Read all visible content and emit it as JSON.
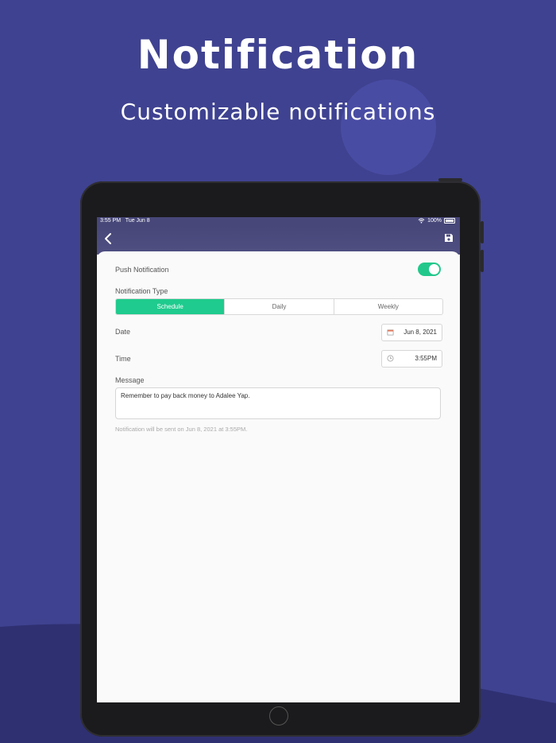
{
  "promo": {
    "title": "Notification",
    "subtitle": "Customizable notifications"
  },
  "status_bar": {
    "time": "3:55 PM",
    "date": "Tue Jun 8",
    "battery": "100%"
  },
  "nav": {
    "back_icon": "chevron-left-icon",
    "save_icon": "floppy-disk-icon"
  },
  "form": {
    "push_label": "Push Notification",
    "push_enabled": true,
    "type_label": "Notification Type",
    "type_options": [
      "Schedule",
      "Daily",
      "Weekly"
    ],
    "type_selected": "Schedule",
    "date_label": "Date",
    "date_value": "Jun 8, 2021",
    "time_label": "Time",
    "time_value": "3:55PM",
    "message_label": "Message",
    "message_value": "Remember to pay back money to Adalee Yap.",
    "hint": "Notification will be sent on Jun 8, 2021 at 3:55PM."
  },
  "colors": {
    "background": "#3f4290",
    "accent": "#1fcb8e",
    "nav": "#47477a"
  }
}
